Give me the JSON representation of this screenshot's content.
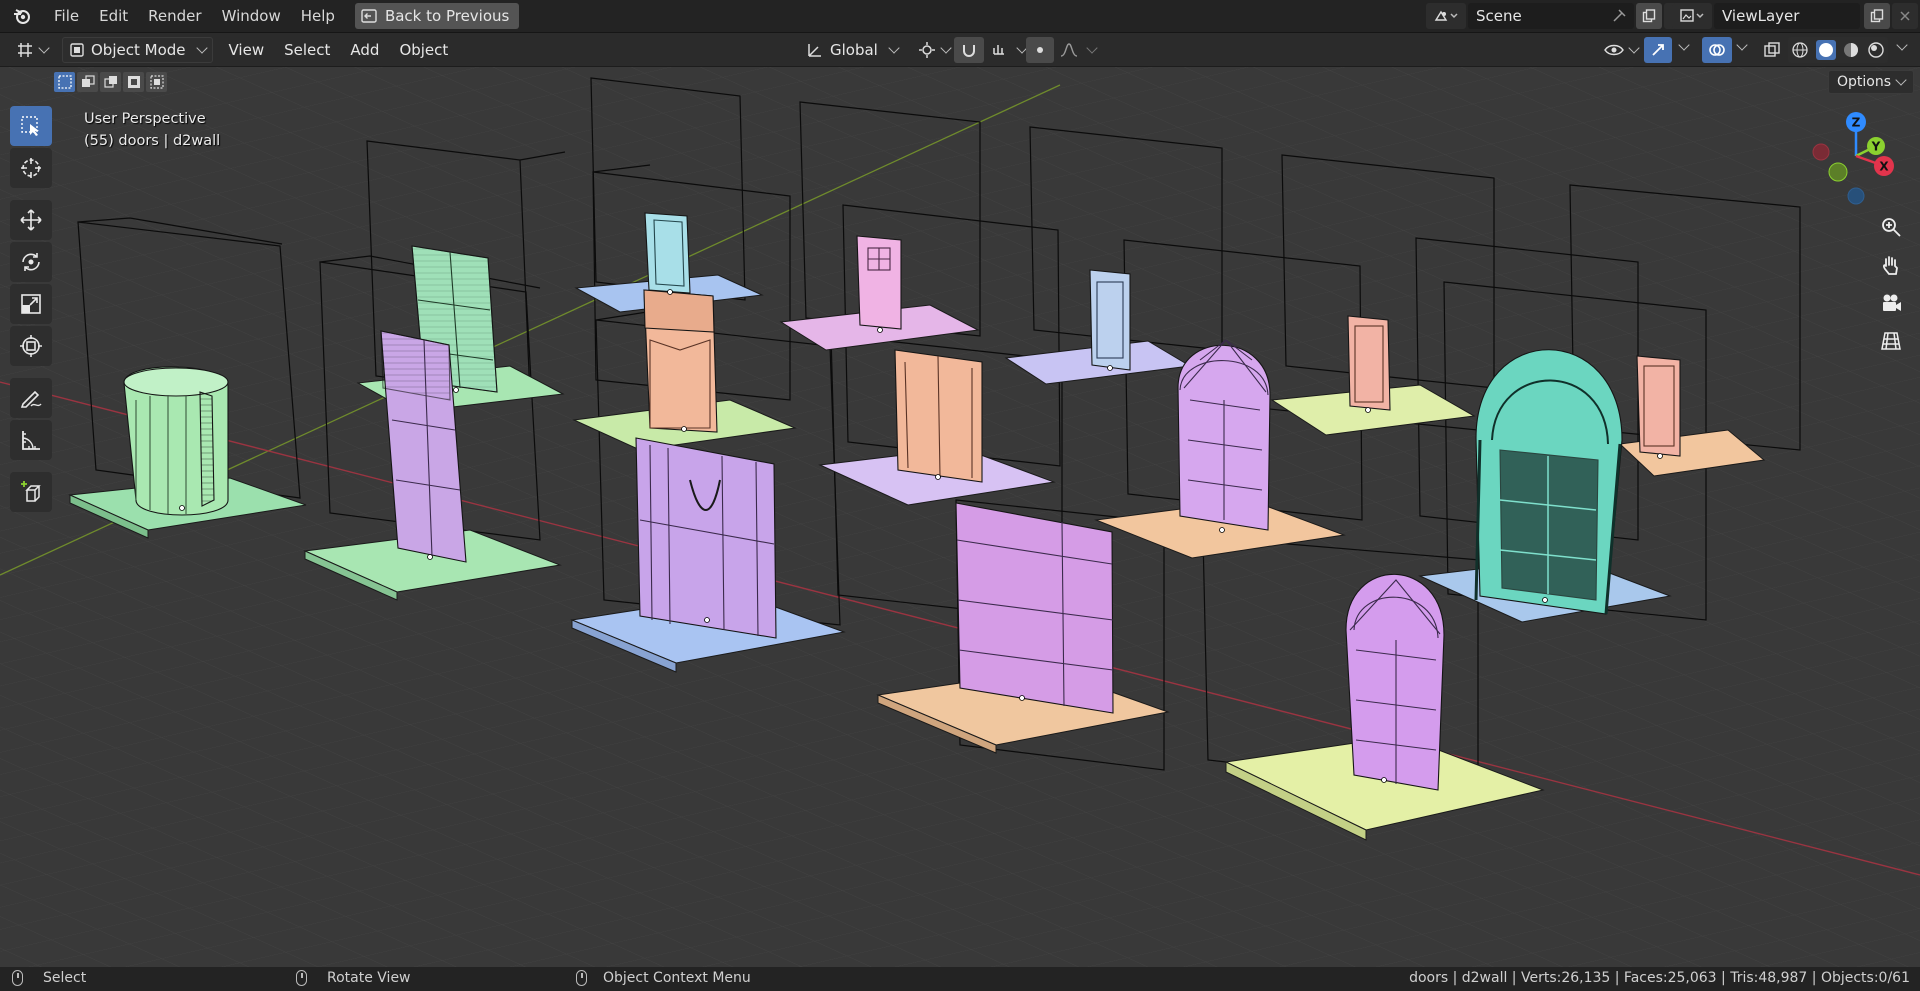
{
  "menu": {
    "items": [
      "File",
      "Edit",
      "Render",
      "Window",
      "Help"
    ],
    "back_button": "Back to Previous"
  },
  "scene": {
    "name": "Scene"
  },
  "view_layer": {
    "name": "ViewLayer"
  },
  "header": {
    "mode": "Object Mode",
    "menus": [
      "View",
      "Select",
      "Add",
      "Object"
    ],
    "orientation": "Global"
  },
  "viewport": {
    "perspective": "User Perspective",
    "collection": "(55) doors | d2wall",
    "options": "Options"
  },
  "gizmo": {
    "x": "X",
    "y": "Y",
    "z": "Z"
  },
  "statusbar": {
    "select": "Select",
    "rotate": "Rotate View",
    "context": "Object Context Menu",
    "stats": "doors | d2wall | Verts:26,135 | Faces:25,063 | Tris:48,987 | Objects:0/61"
  },
  "colors": {
    "accent": "#4772b3",
    "axis_x": "#e2344c",
    "axis_y": "#8bd12f",
    "axis_z": "#2f8bff"
  },
  "icons": [
    "blender-logo-icon",
    "back-icon",
    "scene-icon",
    "pin-icon",
    "copy-icon",
    "close-icon",
    "viewlayer-icon",
    "editor-type-icon",
    "object-mode-icon",
    "orientation-icon",
    "pivot-icon",
    "snap-icon",
    "proportional-icon",
    "visibility-icon",
    "gizmo-icon",
    "overlay-icon",
    "xray-icon",
    "wireframe-icon",
    "solid-icon",
    "material-icon",
    "rendered-icon",
    "select-box-icon",
    "cursor-icon",
    "move-icon",
    "rotate-icon",
    "scale-icon",
    "transform-icon",
    "annotate-icon",
    "measure-icon",
    "add-cube-icon",
    "zoom-icon",
    "hand-icon",
    "camera-icon",
    "grid-icon"
  ]
}
